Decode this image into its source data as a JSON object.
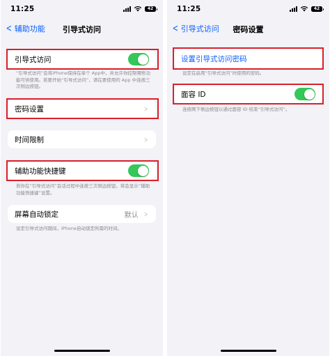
{
  "status_bar": {
    "time": "11:25",
    "battery": "42"
  },
  "left_screen": {
    "back_label": "辅助功能",
    "title": "引导式访问",
    "guided_access": {
      "label": "引导式访问",
      "enabled": true,
      "footnote": "“引导式访问”会将iPhone保持在单个 App中，并允许你控制哪些功能可供使用。若要开始“引导式访问”，请在要使用的 App 中连按三次侧边按钮。"
    },
    "passcode_settings": {
      "label": "密码设置"
    },
    "time_limits": {
      "label": "时间限制"
    },
    "accessibility_shortcut": {
      "label": "辅助功能快捷键",
      "enabled": true,
      "footnote": "若你在“引导式访问”会话过程中连按三次侧边按钮，将会显示“辅助功能快捷键”设置。"
    },
    "auto_lock": {
      "label": "屏幕自动锁定",
      "value": "默认",
      "footnote": "设定引导式访问期间，iPhone自动锁定所需的时间。"
    }
  },
  "right_screen": {
    "back_label": "引导式访问",
    "title": "密码设置",
    "set_passcode": {
      "label": "设置引导式访问密码",
      "footnote": "设定在启用“引导式访问”时使用的密码。"
    },
    "face_id": {
      "label": "面容 ID",
      "enabled": true,
      "footnote": "连按两下侧边按钮以通过面容 ID 结束“引导式访问”。"
    }
  },
  "colors": {
    "accent": "#0a60ff",
    "toggle_on": "#34c759",
    "highlight": "#d8202a",
    "background": "#f2f2f7"
  }
}
